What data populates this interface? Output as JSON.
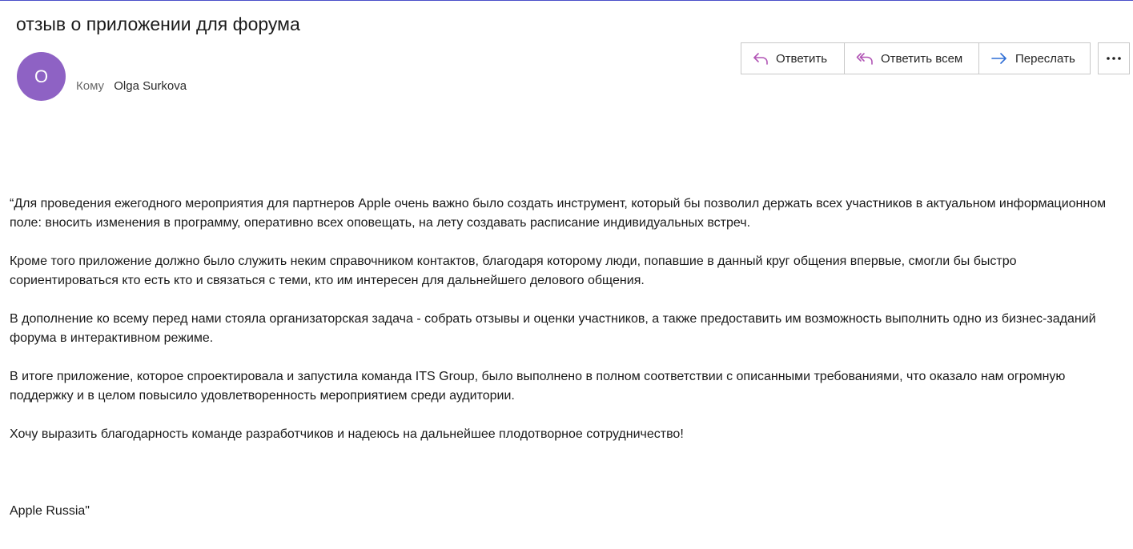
{
  "message": {
    "subject": "отзыв о приложении для форума",
    "avatar_initial": "O",
    "avatar_color": "#8e62c4",
    "to_label": "Кому",
    "to_name": "Olga Surkova"
  },
  "actions": {
    "reply_label": "Ответить",
    "reply_all_label": "Ответить всем",
    "forward_label": "Переслать",
    "more_icon": "more-horizontal-icon",
    "reply_icon_color": "#b155b5",
    "forward_icon_color": "#2f6fd6"
  },
  "body": {
    "paragraphs": [
      "“Для проведения ежегодного мероприятия для партнеров Apple очень важно было создать инструмент, который бы позволил держать всех участников в актуальном информационном поле: вносить изменения в программу, оперативно всех оповещать, на лету создавать расписание индивидуальных встреч.",
      "Кроме того приложение должно было служить неким справочником контактов, благодаря которому люди, попавшие в данный круг общения впервые, смогли бы быстро сориентироваться кто есть кто и связаться с теми, кто им интересен для дальнейшего делового общения.",
      "В дополнение ко всему перед нами стояла организаторская задача - собрать отзывы и оценки участников, а также предоставить им возможность выполнить одно из бизнес-заданий форума в интерактивном режиме.",
      "В итоге приложение, которое спроектировала и запустила команда ITS Group, было выполнено в полном соответствии с описанными требованиями, что оказало нам огромную поддержку и в целом повысило удовлетворенность мероприятием среди аудитории.",
      "Хочу выразить благодарность команде разработчиков и надеюсь на дальнейшее плодотворное сотрудничество!"
    ],
    "signature": "Apple Russia\""
  }
}
